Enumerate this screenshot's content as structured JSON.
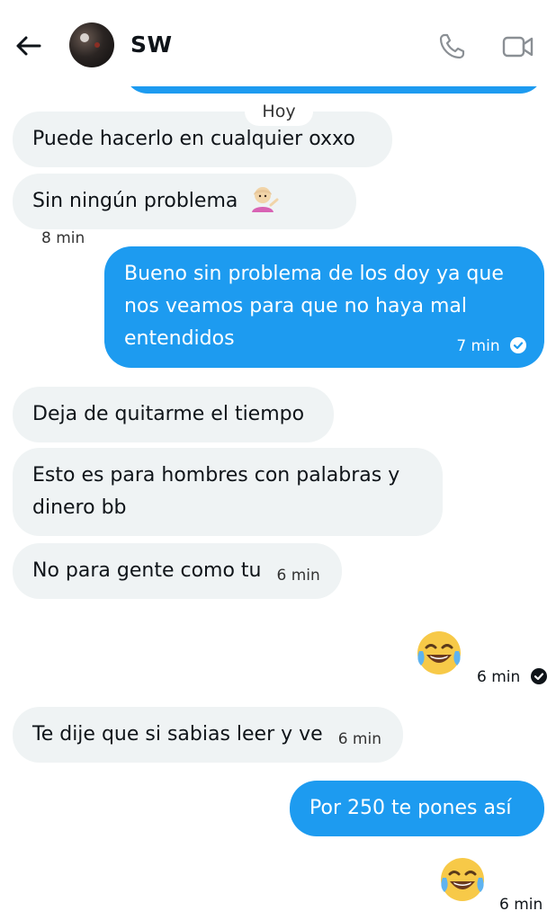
{
  "header": {
    "contact_name": "SW"
  },
  "date_chip": "Hoy",
  "messages": [
    {
      "side": "in",
      "text": "Puede hacerlo en cualquier oxxo"
    },
    {
      "side": "in",
      "text": "Sin ningún problema",
      "time": "8 min"
    },
    {
      "side": "out",
      "lines": [
        "Bueno sin problema de los doy ya que",
        "nos veamos para que no haya mal",
        "entendidos"
      ],
      "time": "7 min",
      "read": true
    },
    {
      "side": "in",
      "text": "Deja de quitarme el tiempo"
    },
    {
      "side": "in",
      "lines": [
        "Esto es para hombres con palabras y",
        "dinero bb"
      ]
    },
    {
      "side": "in",
      "text": "No para gente como tu",
      "time": "6 min"
    },
    {
      "side": "out",
      "emoji": "face-with-tears-of-joy",
      "time": "6 min",
      "read": true
    },
    {
      "side": "in",
      "text": "Te dije que si sabias leer y ve",
      "time": "6 min"
    },
    {
      "side": "out",
      "text": "Por 250 te pones así"
    },
    {
      "side": "out",
      "emoji": "face-with-tears-of-joy",
      "time": "6 min"
    }
  ],
  "colors": {
    "accent": "#1d9bf0",
    "incoming_bubble": "#eff3f4"
  }
}
